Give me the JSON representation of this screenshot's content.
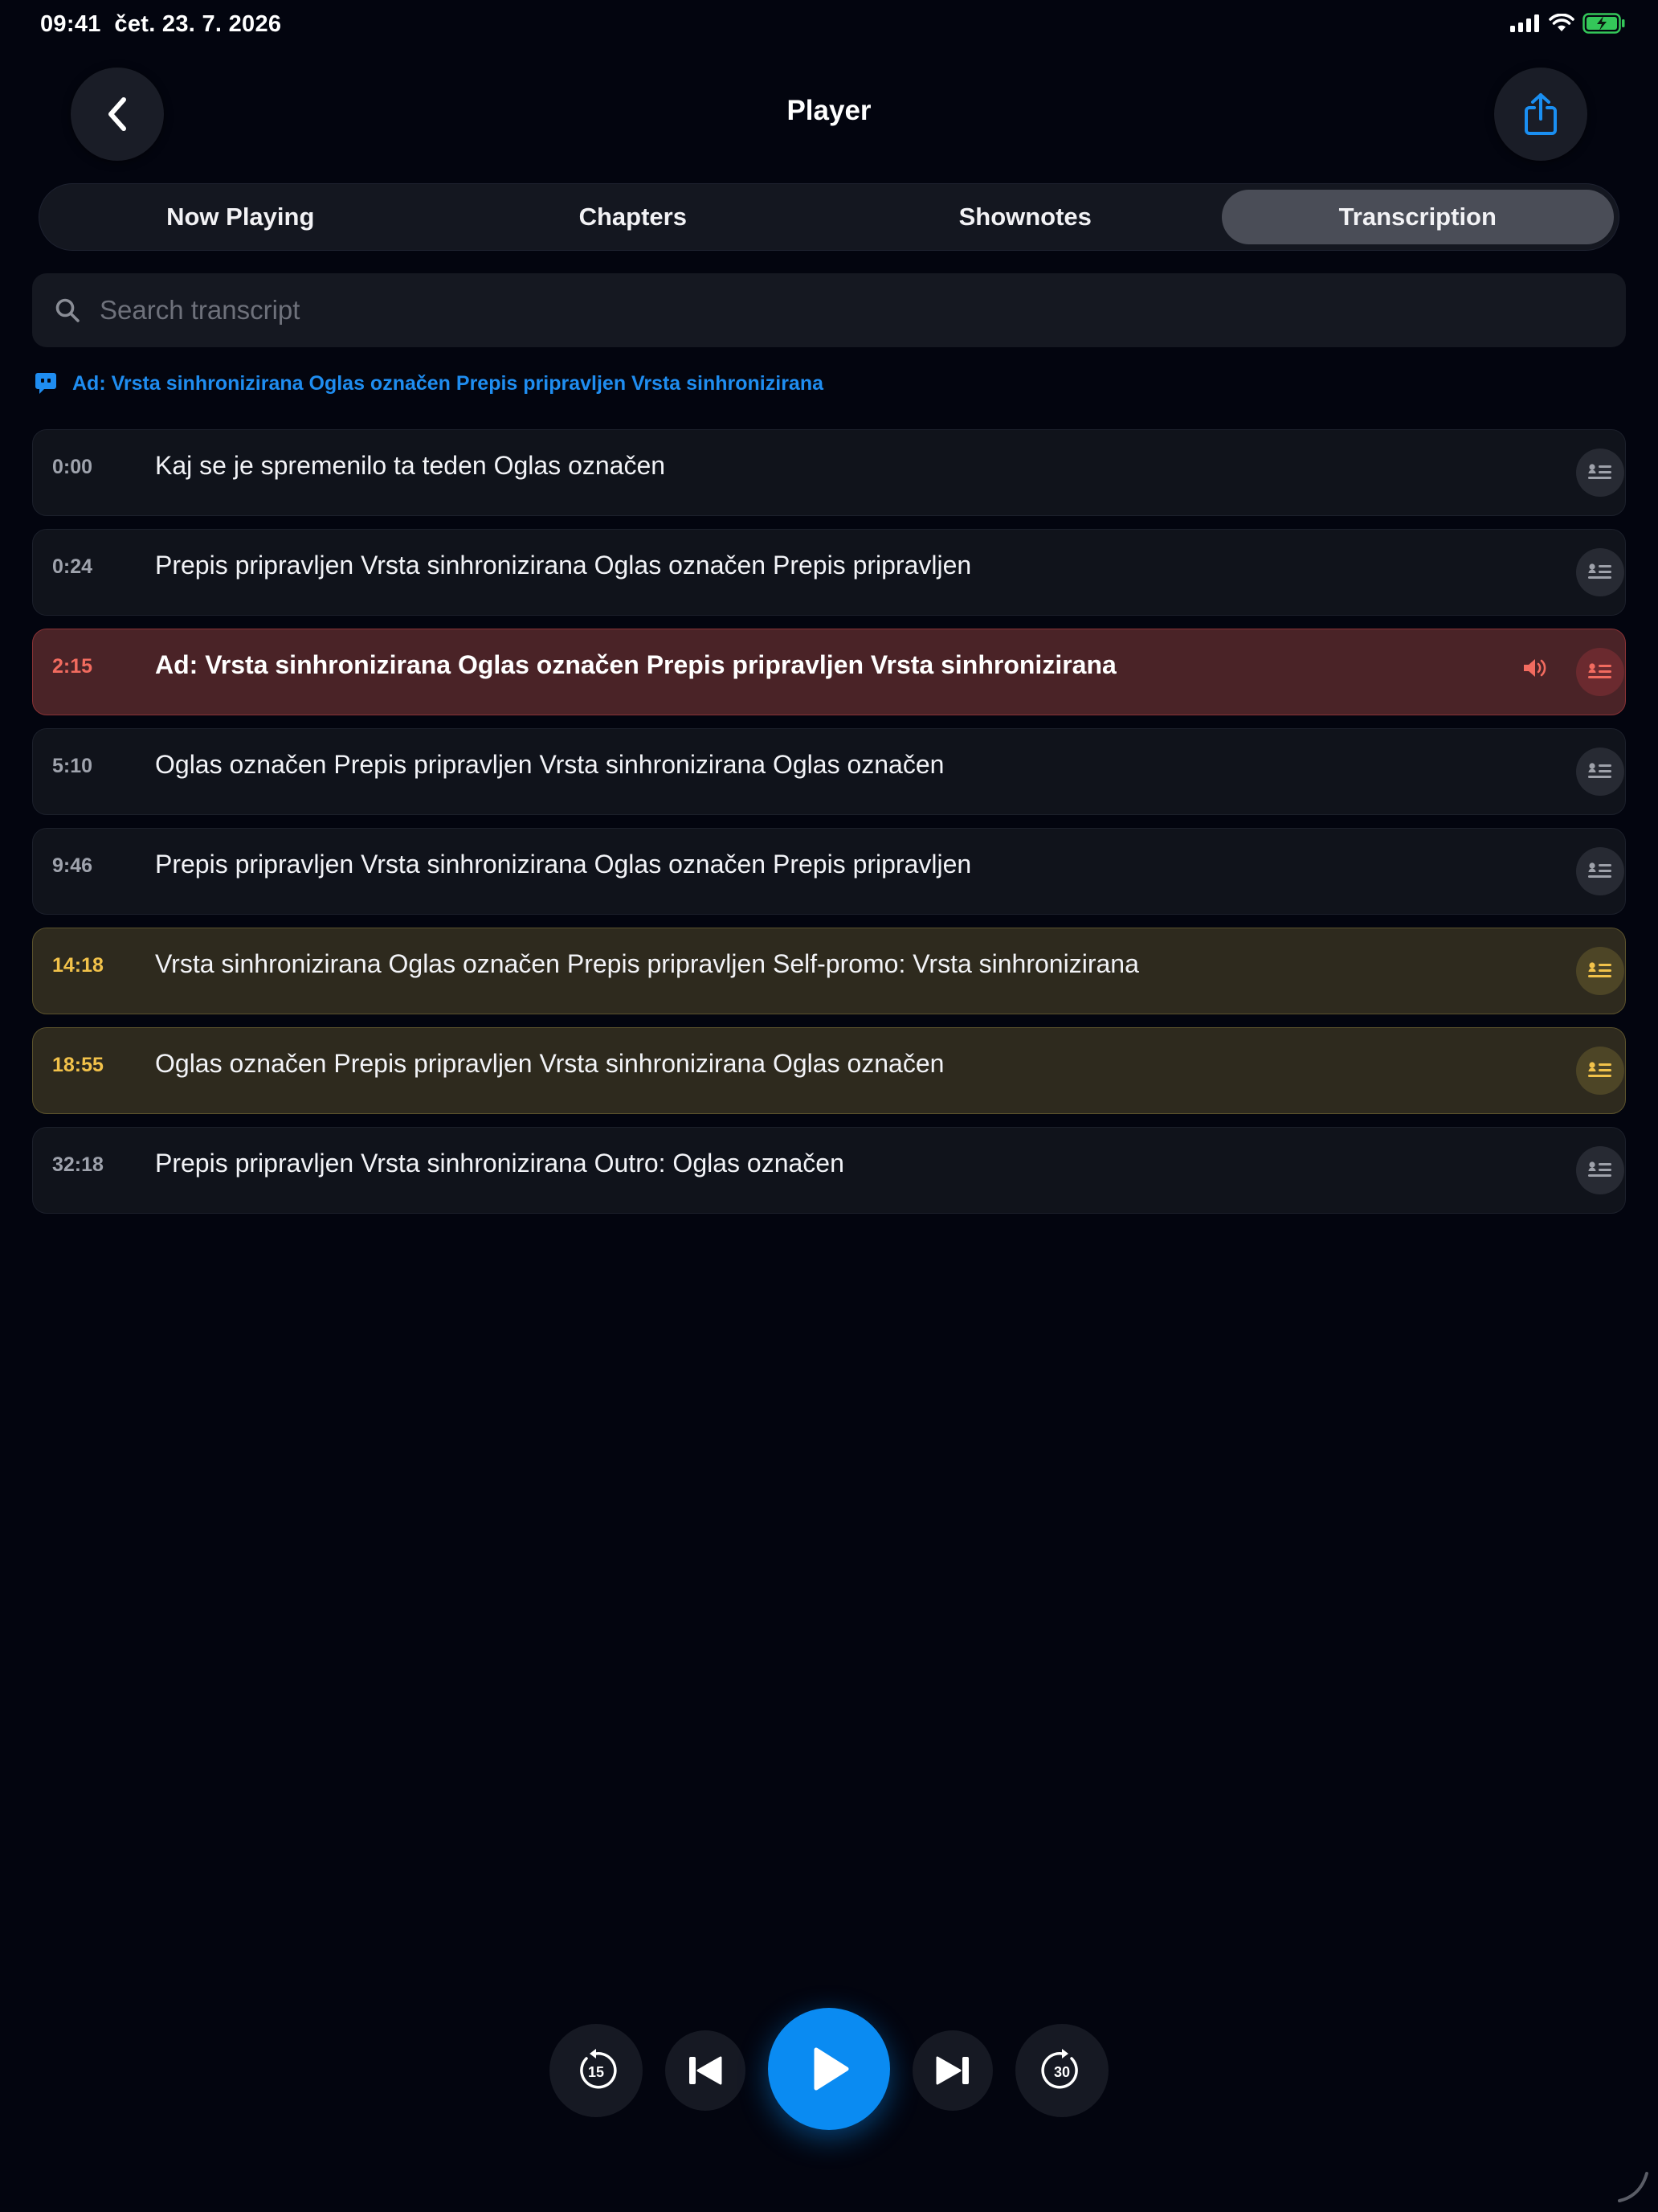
{
  "status_bar": {
    "time": "09:41",
    "date": "čet. 23. 7. 2026"
  },
  "header": {
    "title": "Player"
  },
  "tabs": [
    {
      "label": "Now Playing",
      "active": false
    },
    {
      "label": "Chapters",
      "active": false
    },
    {
      "label": "Shownotes",
      "active": false
    },
    {
      "label": "Transcription",
      "active": true
    }
  ],
  "search": {
    "placeholder": "Search transcript",
    "value": ""
  },
  "now_playing_banner": {
    "text": "Ad: Vrsta sinhronizirana Oglas označen Prepis pripravljen Vrsta sinhronizirana"
  },
  "segments": [
    {
      "time": "0:00",
      "text": "Kaj se je spremenilo ta teden Oglas označen",
      "state": "normal"
    },
    {
      "time": "0:24",
      "text": "Prepis pripravljen Vrsta sinhronizirana Oglas označen Prepis pripravljen",
      "state": "normal"
    },
    {
      "time": "2:15",
      "text": "Ad: Vrsta sinhronizirana Oglas označen Prepis pripravljen Vrsta sinhronizirana",
      "state": "playing"
    },
    {
      "time": "5:10",
      "text": "Oglas označen Prepis pripravljen Vrsta sinhronizirana Oglas označen",
      "state": "normal"
    },
    {
      "time": "9:46",
      "text": "Prepis pripravljen Vrsta sinhronizirana Oglas označen Prepis pripravljen",
      "state": "normal"
    },
    {
      "time": "14:18",
      "text": "Vrsta sinhronizirana Oglas označen Prepis pripravljen Self-promo: Vrsta sinhronizirana",
      "state": "promo"
    },
    {
      "time": "18:55",
      "text": "Oglas označen Prepis pripravljen Vrsta sinhronizirana Oglas označen",
      "state": "promo"
    },
    {
      "time": "32:18",
      "text": "Prepis pripravljen Vrsta sinhronizirana Outro: Oglas označen",
      "state": "normal"
    }
  ],
  "controls": {
    "skip_back_seconds": "15",
    "skip_forward_seconds": "30"
  },
  "colors": {
    "accent": "#0a8bf2",
    "playing_bg": "#4a2327",
    "playing_text": "#f26b5f",
    "promo_bg": "#2e2a1e",
    "promo_text": "#f2c24a",
    "battery": "#34c759"
  },
  "icons": [
    "back-chevron-icon",
    "share-icon",
    "search-icon",
    "chat-bubble-icon",
    "list-detail-icon",
    "speaker-icon",
    "skip-back-15-icon",
    "previous-track-icon",
    "play-icon",
    "next-track-icon",
    "skip-forward-30-icon"
  ]
}
